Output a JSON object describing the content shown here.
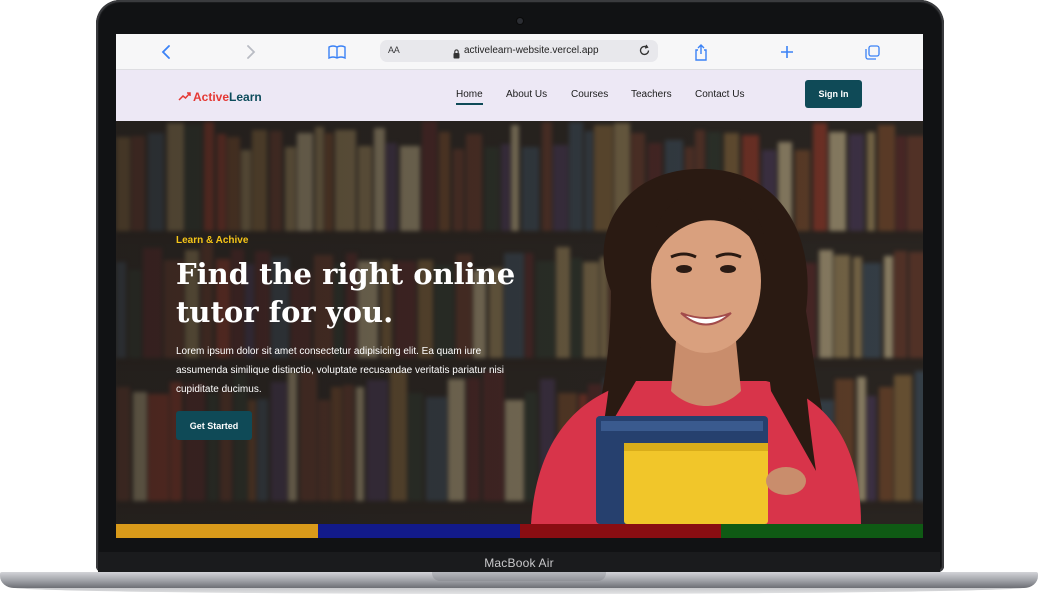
{
  "device": {
    "label": "MacBook Air"
  },
  "browser": {
    "url": "activelearn-website.vercel.app",
    "text_size_label": "AA",
    "icons": [
      "back-icon",
      "forward-icon",
      "bookmarks-icon",
      "lock-icon",
      "reload-icon",
      "share-icon",
      "new-tab-icon",
      "tabs-icon"
    ]
  },
  "site": {
    "logo": {
      "part1": "Active",
      "part2": "Learn",
      "icon": "trending-up-icon"
    },
    "nav": [
      {
        "label": "Home",
        "active": true
      },
      {
        "label": "About Us",
        "active": false
      },
      {
        "label": "Courses",
        "active": false
      },
      {
        "label": "Teachers",
        "active": false
      },
      {
        "label": "Contact Us",
        "active": false
      }
    ],
    "signin_label": "Sign In"
  },
  "hero": {
    "tagline": "Learn & Achive",
    "headline_line1": "Find the right online",
    "headline_line2": "tutor for you.",
    "description": "Lorem ipsum dolor sit amet consectetur adipisicing elit. Ea quam iure assumenda similique distinctio, voluptate recusandae veritatis pariatur nisi cupiditate ducimus.",
    "cta_label": "Get Started"
  },
  "colors": {
    "brand": "#0f4a57",
    "accent": "#f5c518",
    "logo_red": "#e53935",
    "stripes": [
      "#d99a1a",
      "#121a8a",
      "#8a0d12",
      "#0f5a14"
    ]
  }
}
